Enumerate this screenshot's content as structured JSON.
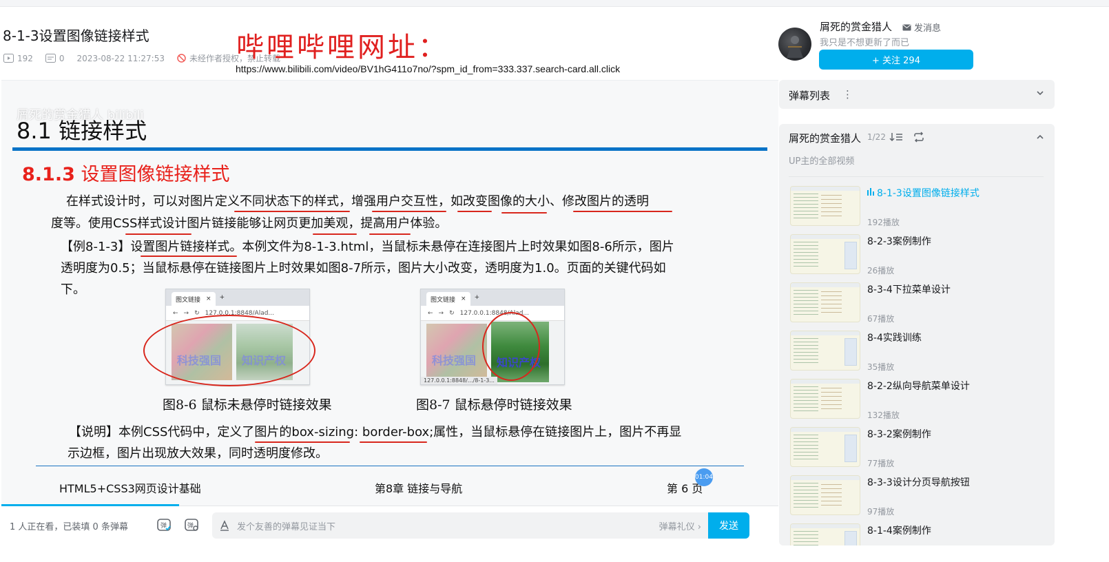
{
  "video": {
    "title": "8-1-3设置图像链接样式",
    "views": "192",
    "comments": "0",
    "datetime": "2023-08-22 11:27:53",
    "warning": "未经作者授权，禁止转载"
  },
  "overlay": {
    "handwritten": "哔哩哔哩网址：",
    "url": "https://www.bilibili.com/video/BV1hG411o7no/?spm_id_from=333.337.search-card.all.click"
  },
  "slide": {
    "watermark": "屑死的赏金猎人 bilibili",
    "heading": "8.1 链接样式",
    "subheading_num": "8.1.3",
    "subheading_text": " 设置图像链接样式",
    "para1_line1": "在样式设计时，可以对图片定义不同状态下的样式，增强用户交互性，如改变图像的大小、修改图片的透明",
    "para1_line2": "度等。使用CSS样式设计图片链接能够让网页更加美观，提高用户体验。",
    "para2_line1": "【例8-1-3】设置图片链接样式。本例文件为8-1-3.html，当鼠标未悬停在连接图片上时效果如图8-6所示，图片",
    "para2_line2": "透明度为0.5；当鼠标悬停在链接图片上时效果如图8-7所示，图片大小改变，透明度为1.0。页面的关键代码如",
    "para2_line3": "下。",
    "fig1": {
      "tab": "图文链接",
      "addr": "127.0.0.1:8848/Alad...",
      "img1_label": "科技强国",
      "img2_label": "知识产权",
      "caption": "图8-6  鼠标未悬停时链接效果"
    },
    "fig2": {
      "tab": "图文链接",
      "addr": "127.0.0.1:8848/Alad...",
      "img1_label": "科技强国",
      "img2_label": "知识产权",
      "status": "127.0.0.1:8848/.../8-1-3...",
      "caption": "图8-7  鼠标悬停时链接效果"
    },
    "note_line1": "【说明】本例CSS代码中，定义了图片的box-sizing: border-box;属性，当鼠标悬停在链接图片上，图片不再显",
    "note_line2": "示边框，图片出现放大效果，同时透明度修改。",
    "footer_left": "HTML5+CSS3网页设计基础",
    "footer_center": "第8章 链接与导航",
    "footer_right": "第 6 页",
    "time_badge": "01:04"
  },
  "danmaku_bar": {
    "viewers": "1 人正在看，已装填 0 条弹幕",
    "placeholder": "发个友善的弹幕见证当下",
    "etiquette": "弹幕礼仪 ›",
    "send": "发送"
  },
  "uploader": {
    "name": "屑死的赏金猎人",
    "message": "发消息",
    "signature": "我只是不想更新了而已",
    "follow": "+ 关注 294"
  },
  "danmaku_list": {
    "title": "弹幕列表",
    "menu": "⋮"
  },
  "playlist": {
    "title": "屑死的赏金猎人",
    "count": "1/22",
    "subtitle": "UP主的全部视频",
    "items": [
      {
        "name": "8-1-3设置图像链接样式",
        "plays": "192播放"
      },
      {
        "name": "8-2-3案例制作",
        "plays": "26播放"
      },
      {
        "name": "8-3-4下拉菜单设计",
        "plays": "67播放"
      },
      {
        "name": "8-4实践训练",
        "plays": "35播放"
      },
      {
        "name": "8-2-2纵向导航菜单设计",
        "plays": "132播放"
      },
      {
        "name": "8-3-2案例制作",
        "plays": "77播放"
      },
      {
        "name": "8-3-3设计分页导航按钮",
        "plays": "97播放"
      },
      {
        "name": "8-1-4案例制作",
        "plays": ""
      }
    ]
  },
  "colors": {
    "accent": "#00aeec",
    "slide_red": "#e8211b",
    "slide_blue_rule": "#0a73c7"
  }
}
